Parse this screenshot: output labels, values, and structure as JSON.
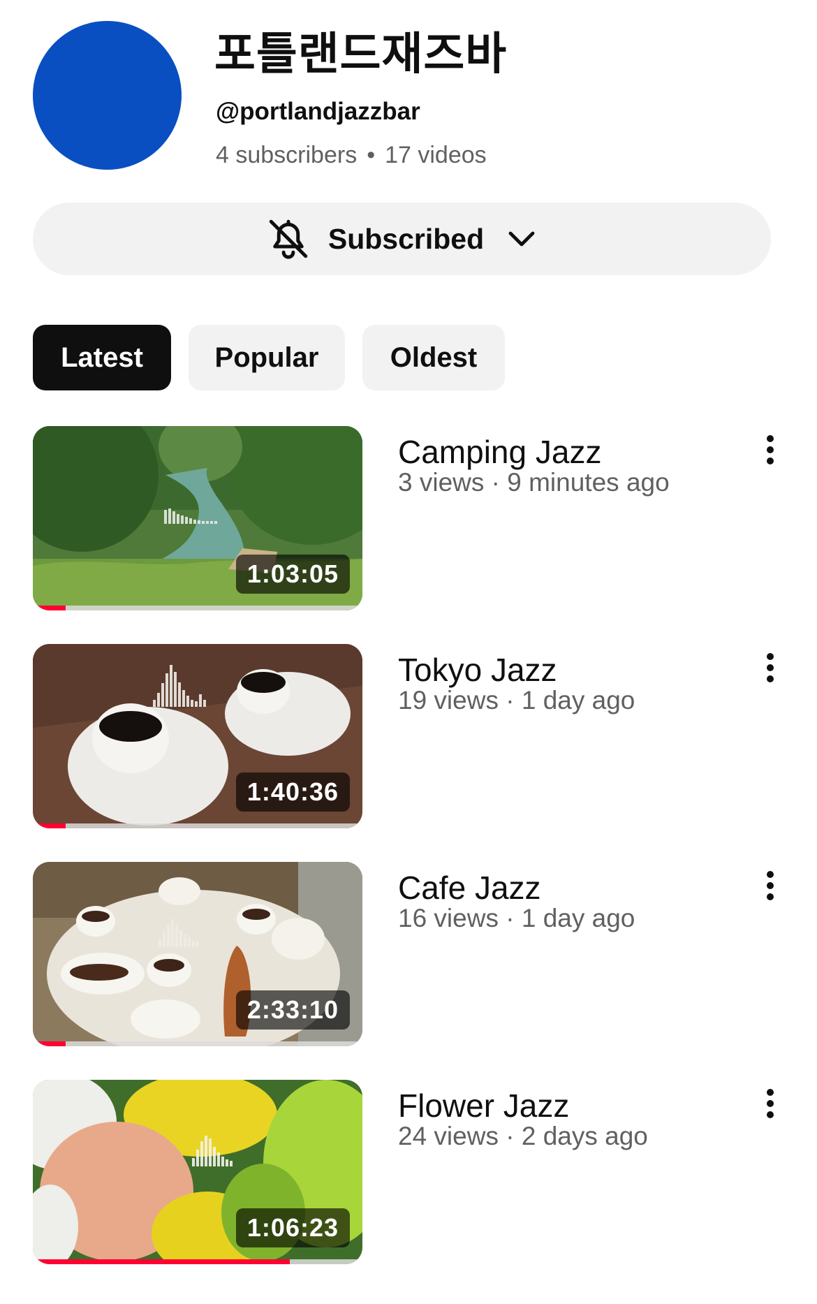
{
  "channel": {
    "name": "포틀랜드재즈바",
    "handle": "@portlandjazzbar",
    "subscribers": "4 subscribers",
    "separator": "•",
    "videos": "17 videos",
    "avatar_color": "#0a4fc1"
  },
  "subscribe": {
    "label": "Subscribed",
    "icon": "bell-off-icon",
    "dropdown_icon": "chevron-down-icon"
  },
  "filters": {
    "active": "Latest",
    "chips": [
      {
        "label": "Latest"
      },
      {
        "label": "Popular"
      },
      {
        "label": "Oldest"
      }
    ]
  },
  "videos": [
    {
      "title": "Camping Jazz",
      "meta": "3 views · 9 minutes ago",
      "duration": "1:03:05",
      "watched_fraction": 0.1
    },
    {
      "title": "Tokyo Jazz",
      "meta": "19 views · 1 day ago",
      "duration": "1:40:36",
      "watched_fraction": 0.1
    },
    {
      "title": "Cafe Jazz",
      "meta": "16 views · 1 day ago",
      "duration": "2:33:10",
      "watched_fraction": 0.1
    },
    {
      "title": "Flower Jazz",
      "meta": "24 views · 2 days ago",
      "duration": "1:06:23",
      "watched_fraction": 0.78
    }
  ],
  "colors": {
    "accent_progress": "#ff0033",
    "chip_active_bg": "#0f0f0f",
    "chip_bg": "#f2f2f2",
    "secondary_text": "#606060"
  }
}
